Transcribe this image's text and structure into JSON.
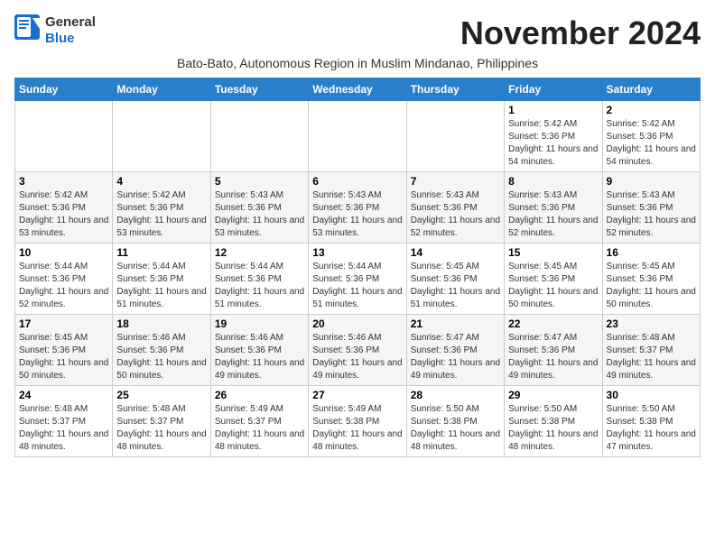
{
  "header": {
    "logo_general": "General",
    "logo_blue": "Blue",
    "month_title": "November 2024",
    "subtitle": "Bato-Bato, Autonomous Region in Muslim Mindanao, Philippines"
  },
  "days_of_week": [
    "Sunday",
    "Monday",
    "Tuesday",
    "Wednesday",
    "Thursday",
    "Friday",
    "Saturday"
  ],
  "weeks": [
    {
      "days": [
        {
          "num": "",
          "info": ""
        },
        {
          "num": "",
          "info": ""
        },
        {
          "num": "",
          "info": ""
        },
        {
          "num": "",
          "info": ""
        },
        {
          "num": "",
          "info": ""
        },
        {
          "num": "1",
          "info": "Sunrise: 5:42 AM\nSunset: 5:36 PM\nDaylight: 11 hours and 54 minutes."
        },
        {
          "num": "2",
          "info": "Sunrise: 5:42 AM\nSunset: 5:36 PM\nDaylight: 11 hours and 54 minutes."
        }
      ]
    },
    {
      "days": [
        {
          "num": "3",
          "info": "Sunrise: 5:42 AM\nSunset: 5:36 PM\nDaylight: 11 hours and 53 minutes."
        },
        {
          "num": "4",
          "info": "Sunrise: 5:42 AM\nSunset: 5:36 PM\nDaylight: 11 hours and 53 minutes."
        },
        {
          "num": "5",
          "info": "Sunrise: 5:43 AM\nSunset: 5:36 PM\nDaylight: 11 hours and 53 minutes."
        },
        {
          "num": "6",
          "info": "Sunrise: 5:43 AM\nSunset: 5:36 PM\nDaylight: 11 hours and 53 minutes."
        },
        {
          "num": "7",
          "info": "Sunrise: 5:43 AM\nSunset: 5:36 PM\nDaylight: 11 hours and 52 minutes."
        },
        {
          "num": "8",
          "info": "Sunrise: 5:43 AM\nSunset: 5:36 PM\nDaylight: 11 hours and 52 minutes."
        },
        {
          "num": "9",
          "info": "Sunrise: 5:43 AM\nSunset: 5:36 PM\nDaylight: 11 hours and 52 minutes."
        }
      ]
    },
    {
      "days": [
        {
          "num": "10",
          "info": "Sunrise: 5:44 AM\nSunset: 5:36 PM\nDaylight: 11 hours and 52 minutes."
        },
        {
          "num": "11",
          "info": "Sunrise: 5:44 AM\nSunset: 5:36 PM\nDaylight: 11 hours and 51 minutes."
        },
        {
          "num": "12",
          "info": "Sunrise: 5:44 AM\nSunset: 5:36 PM\nDaylight: 11 hours and 51 minutes."
        },
        {
          "num": "13",
          "info": "Sunrise: 5:44 AM\nSunset: 5:36 PM\nDaylight: 11 hours and 51 minutes."
        },
        {
          "num": "14",
          "info": "Sunrise: 5:45 AM\nSunset: 5:36 PM\nDaylight: 11 hours and 51 minutes."
        },
        {
          "num": "15",
          "info": "Sunrise: 5:45 AM\nSunset: 5:36 PM\nDaylight: 11 hours and 50 minutes."
        },
        {
          "num": "16",
          "info": "Sunrise: 5:45 AM\nSunset: 5:36 PM\nDaylight: 11 hours and 50 minutes."
        }
      ]
    },
    {
      "days": [
        {
          "num": "17",
          "info": "Sunrise: 5:45 AM\nSunset: 5:36 PM\nDaylight: 11 hours and 50 minutes."
        },
        {
          "num": "18",
          "info": "Sunrise: 5:46 AM\nSunset: 5:36 PM\nDaylight: 11 hours and 50 minutes."
        },
        {
          "num": "19",
          "info": "Sunrise: 5:46 AM\nSunset: 5:36 PM\nDaylight: 11 hours and 49 minutes."
        },
        {
          "num": "20",
          "info": "Sunrise: 5:46 AM\nSunset: 5:36 PM\nDaylight: 11 hours and 49 minutes."
        },
        {
          "num": "21",
          "info": "Sunrise: 5:47 AM\nSunset: 5:36 PM\nDaylight: 11 hours and 49 minutes."
        },
        {
          "num": "22",
          "info": "Sunrise: 5:47 AM\nSunset: 5:36 PM\nDaylight: 11 hours and 49 minutes."
        },
        {
          "num": "23",
          "info": "Sunrise: 5:48 AM\nSunset: 5:37 PM\nDaylight: 11 hours and 49 minutes."
        }
      ]
    },
    {
      "days": [
        {
          "num": "24",
          "info": "Sunrise: 5:48 AM\nSunset: 5:37 PM\nDaylight: 11 hours and 48 minutes."
        },
        {
          "num": "25",
          "info": "Sunrise: 5:48 AM\nSunset: 5:37 PM\nDaylight: 11 hours and 48 minutes."
        },
        {
          "num": "26",
          "info": "Sunrise: 5:49 AM\nSunset: 5:37 PM\nDaylight: 11 hours and 48 minutes."
        },
        {
          "num": "27",
          "info": "Sunrise: 5:49 AM\nSunset: 5:38 PM\nDaylight: 11 hours and 48 minutes."
        },
        {
          "num": "28",
          "info": "Sunrise: 5:50 AM\nSunset: 5:38 PM\nDaylight: 11 hours and 48 minutes."
        },
        {
          "num": "29",
          "info": "Sunrise: 5:50 AM\nSunset: 5:38 PM\nDaylight: 11 hours and 48 minutes."
        },
        {
          "num": "30",
          "info": "Sunrise: 5:50 AM\nSunset: 5:38 PM\nDaylight: 11 hours and 47 minutes."
        }
      ]
    }
  ]
}
